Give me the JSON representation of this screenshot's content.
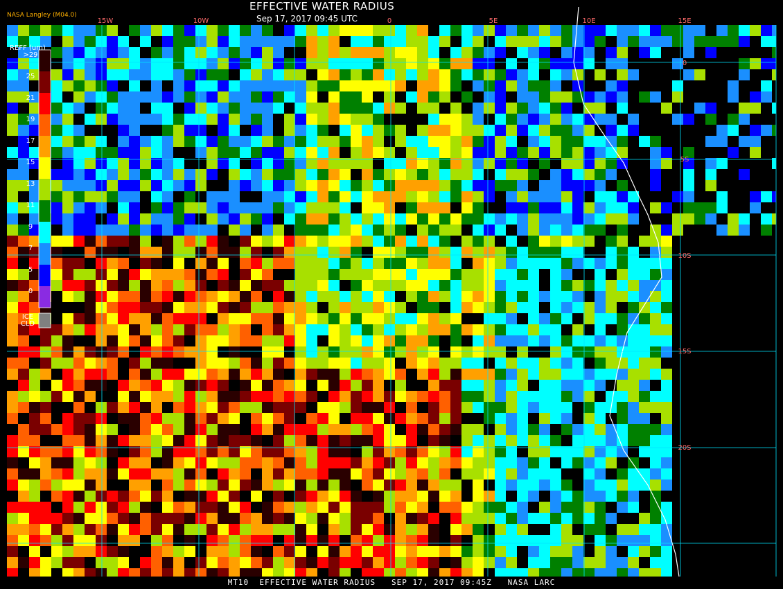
{
  "header": {
    "title": "EFFECTIVE WATER RADIUS",
    "datetime": "Sep 17, 2017 09:45 UTC",
    "source": "NASA Langley (M04.0)"
  },
  "footer": {
    "text": "MT10  EFFECTIVE WATER RADIUS   SEP 17, 2017 09:45Z   NASA LARC"
  },
  "map": {
    "longitude_labels": [
      "15W",
      "10W",
      "0",
      "5E",
      "10E",
      "15E"
    ],
    "latitude_labels": [
      "0",
      "5S",
      "10S",
      "15S",
      "20S"
    ]
  },
  "colorbar": {
    "title": "REFF (um)",
    "labels": [
      ">29",
      "25",
      "21",
      "19",
      "17",
      "15",
      "13",
      "11",
      "9",
      "7",
      "5",
      "0"
    ],
    "colors": [
      "#2a0000",
      "#7a0000",
      "#ff0000",
      "#ff6000",
      "#ffa000",
      "#ffff00",
      "#a8e000",
      "#008000",
      "#00ffff",
      "#1a8fff",
      "#0000ff",
      "#8a2be2"
    ],
    "ice_label_1": "ICE",
    "ice_label_2": "CLD",
    "ice_color": "#808080"
  }
}
